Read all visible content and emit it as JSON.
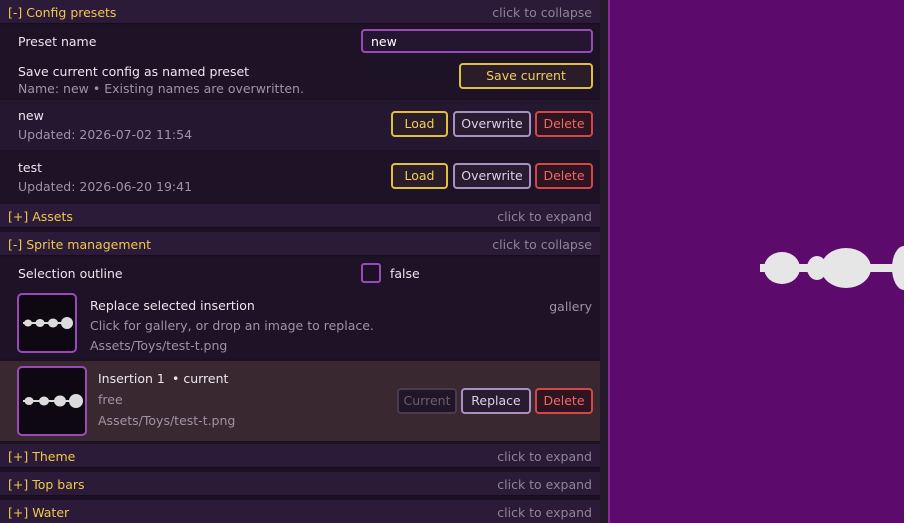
{
  "config_presets": {
    "header": "[-] Config presets",
    "hint": "click to collapse",
    "preset_name_label": "Preset name",
    "preset_name_value": "new",
    "save_label": "Save current config as named preset",
    "save_sub": "Name: new  •  Existing names are overwritten.",
    "save_button": "Save current",
    "presets": [
      {
        "name": "new",
        "updated": "Updated: 2026-07-02 11:54"
      },
      {
        "name": "test",
        "updated": "Updated: 2026-06-20 19:41"
      }
    ],
    "load_button": "Load",
    "overwrite_button": "Overwrite",
    "delete_button": "Delete"
  },
  "assets": {
    "header": "[+] Assets",
    "hint": "click to expand"
  },
  "sprite_management": {
    "header": "[-] Sprite management",
    "hint": "click to collapse",
    "selection_outline_label": "Selection outline",
    "selection_outline_value": "false",
    "replace_title": "Replace selected insertion",
    "replace_desc": "Click for gallery, or drop an image to replace.",
    "replace_path": "Assets/Toys/test-t.png",
    "gallery_link": "gallery",
    "insertion_title": "Insertion 1",
    "insertion_badge": "• current",
    "insertion_mode": "free",
    "insertion_path": "Assets/Toys/test-t.png",
    "current_button": "Current",
    "replace_button": "Replace",
    "delete_button": "Delete"
  },
  "theme": {
    "header": "[+] Theme",
    "hint": "click to expand"
  },
  "top_bars": {
    "header": "[+] Top bars",
    "hint": "click to expand"
  },
  "water": {
    "header": "[+] Water",
    "hint": "click to expand"
  },
  "colors": {
    "accent": "#f0c94a",
    "panel": "#1c1024",
    "viewport": "#5d0a6d",
    "danger": "#d04848"
  }
}
